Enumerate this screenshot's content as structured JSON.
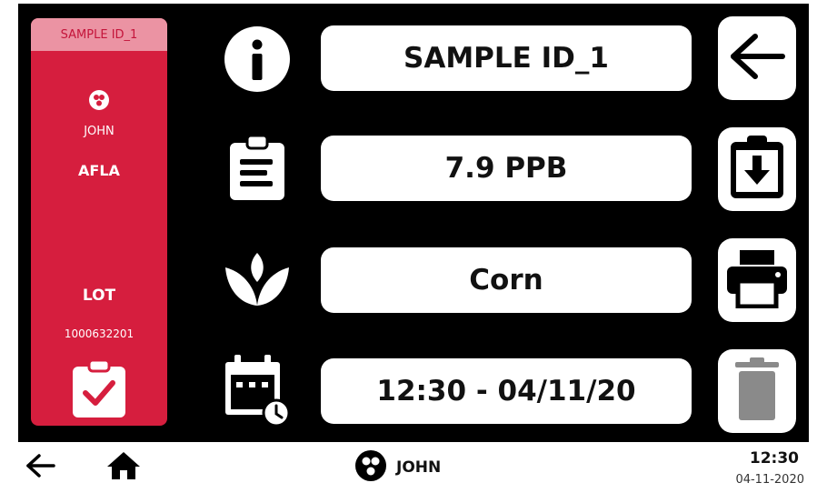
{
  "sample_card": {
    "header": "SAMPLE ID_1",
    "user_icon": "user-badge-icon",
    "user": "JOHN",
    "analyte": "AFLA",
    "lot_label": "LOT",
    "lot_value": "1000632201",
    "status_icon": "clipboard-check-icon"
  },
  "rows": [
    {
      "icon": "info-icon",
      "value": "SAMPLE ID_1",
      "action_icon": "back-arrow-icon"
    },
    {
      "icon": "clipboard-report-icon",
      "value": "7.9 PPB",
      "action_icon": "clipboard-download-icon"
    },
    {
      "icon": "plant-icon",
      "value": "Corn",
      "action_icon": "printer-icon"
    },
    {
      "icon": "calendar-clock-icon",
      "value": "12:30 - 04/11/20",
      "action_icon": "trash-icon"
    }
  ],
  "bottom_bar": {
    "back_icon": "back-arrow-icon",
    "home_icon": "home-icon",
    "user_icon": "user-badge-icon",
    "user": "JOHN",
    "time": "12:30",
    "date": "04-11-2020"
  },
  "colors": {
    "card_red": "#d61e3e",
    "card_header_pink": "#eb93a3",
    "trash_disabled": "#8a8a8a"
  }
}
